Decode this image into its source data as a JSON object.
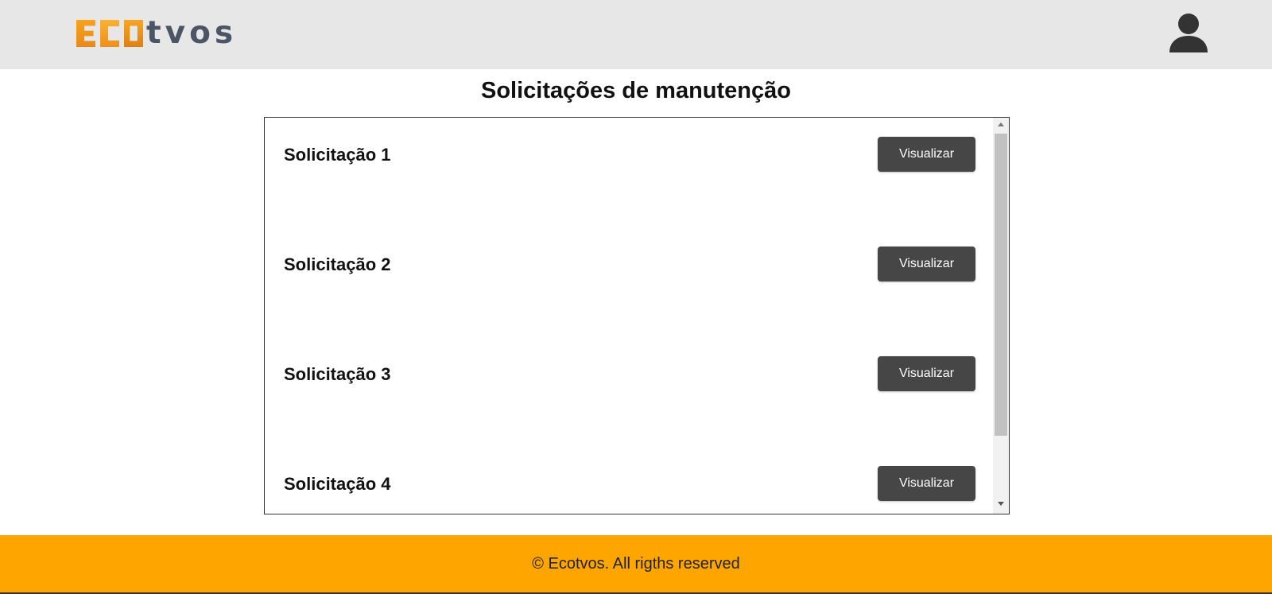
{
  "header": {
    "logo_text": "tvos",
    "logo_wordmark": "Ecotvos",
    "user_icon": "user-icon"
  },
  "page": {
    "title": "Solicitações de manutenção"
  },
  "requests": [
    {
      "label": "Solicitação 1",
      "button": "Visualizar"
    },
    {
      "label": "Solicitação 2",
      "button": "Visualizar"
    },
    {
      "label": "Solicitação 3",
      "button": "Visualizar"
    },
    {
      "label": "Solicitação 4",
      "button": "Visualizar"
    }
  ],
  "footer": {
    "text": "© Ecotvos. All rigths reserved"
  },
  "colors": {
    "header_bg": "#e7e7e7",
    "footer_bg": "#ffa500",
    "button_bg": "#464646",
    "logo_orange": "#f5a623",
    "logo_gray": "#4b5563"
  }
}
